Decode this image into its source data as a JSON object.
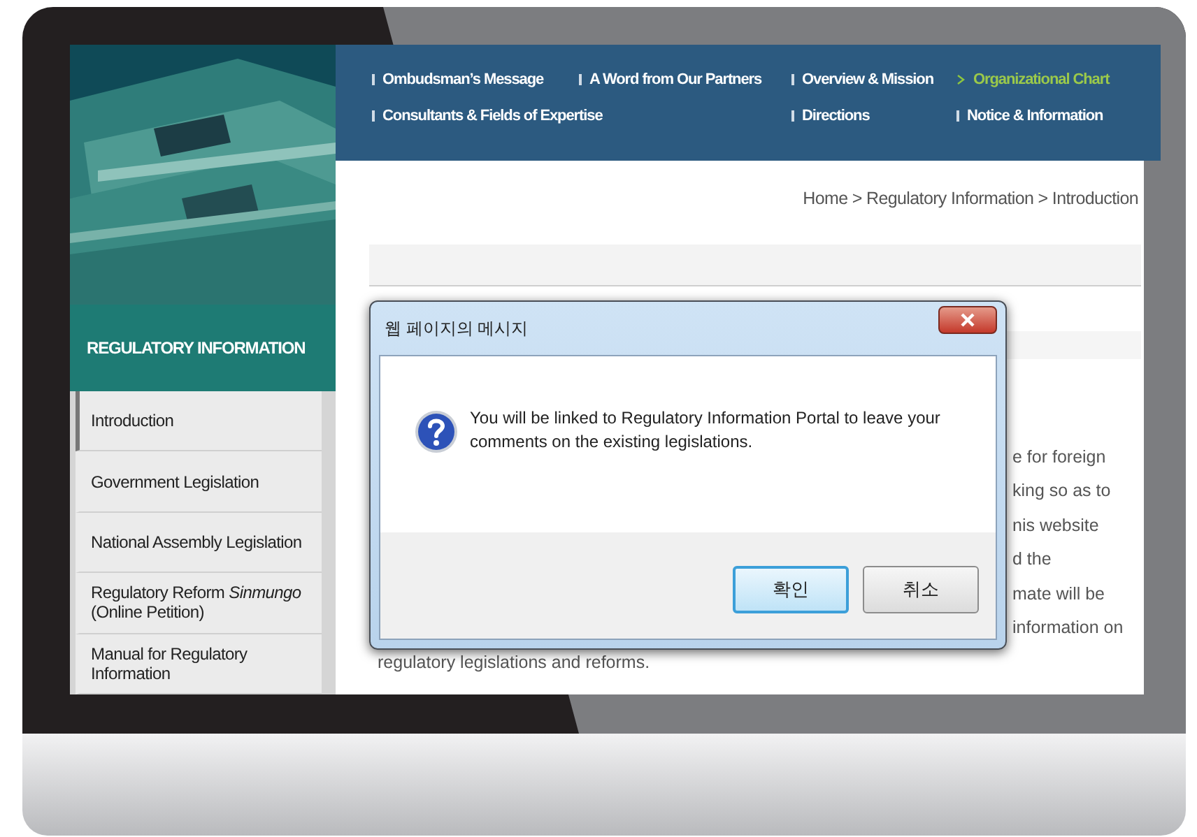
{
  "nav": {
    "rows": [
      [
        {
          "label": "Ombudsman’s Message",
          "selected": false
        },
        {
          "label": "A Word from Our Partners",
          "selected": false
        },
        {
          "label": "Overview & Mission",
          "selected": false
        },
        {
          "label": "Organizational Chart",
          "selected": true
        }
      ],
      [
        {
          "label": "Consultants & Fields of Expertise",
          "selected": false
        },
        null,
        {
          "label": "Directions",
          "selected": false
        },
        {
          "label": "Notice & Information",
          "selected": false
        }
      ]
    ]
  },
  "breadcrumb": "Home > Regulatory Information > Introduction",
  "sidebar": {
    "title": "REGULATORY INFORMATION",
    "items": [
      {
        "label": "Introduction",
        "selected": true
      },
      {
        "label": "Government Legislation",
        "selected": false
      },
      {
        "label": "National Assembly Legislation",
        "selected": false
      },
      {
        "label": "Regulatory Reform *Sinmungo* (Online Petition)",
        "selected": false
      },
      {
        "label": "Manual for Regulatory Information",
        "selected": false
      }
    ]
  },
  "content": {
    "lines": [
      "e for foreign",
      "king so as to",
      "nis website",
      "d the",
      "mate will be",
      "information on",
      "regulatory legislations and reforms."
    ]
  },
  "dialog": {
    "title": "웹 페이지의 메시지",
    "message": "You will be linked to Regulatory Information Portal to leave your comments on the existing legislations.",
    "buttons": [
      {
        "label": "확인",
        "default": true
      },
      {
        "label": "취소",
        "default": false
      }
    ]
  }
}
